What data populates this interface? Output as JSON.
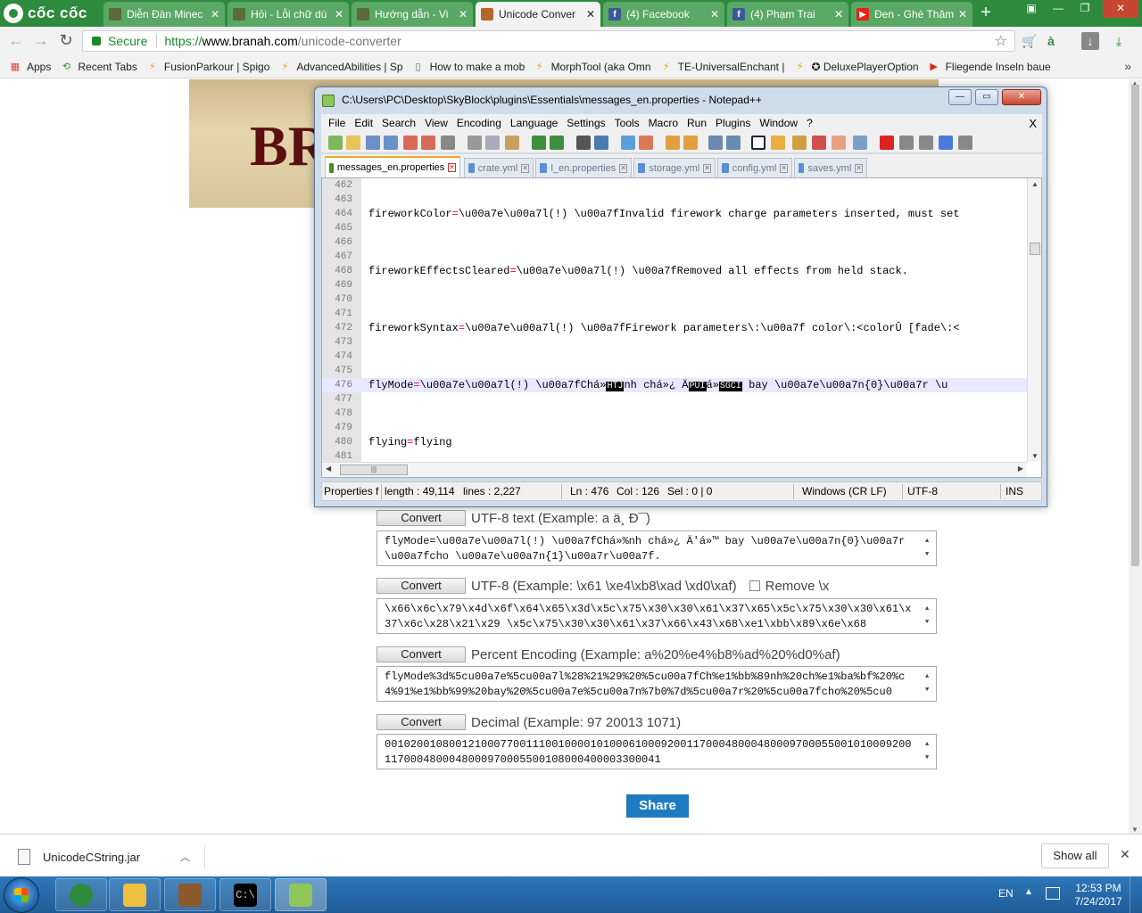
{
  "browser": {
    "brand": "cốc cốc",
    "tabs": [
      {
        "title": "Diễn Đàn Minec",
        "icon": "minecraft-icon",
        "active": false
      },
      {
        "title": "Hỏi - Lỗi chữ dù",
        "icon": "minecraft-icon",
        "active": false
      },
      {
        "title": "Hướng dẫn - Vi",
        "icon": "minecraft-icon",
        "active": false
      },
      {
        "title": "Unicode Conver",
        "icon": "branah-icon",
        "active": true
      },
      {
        "title": "(4) Facebook",
        "icon": "facebook-icon",
        "active": false
      },
      {
        "title": "(4) Phạm Trai",
        "icon": "facebook-icon",
        "active": false
      },
      {
        "title": "Đen - Ghé Thăm",
        "icon": "youtube-icon",
        "active": false
      }
    ],
    "secure_label": "Secure",
    "url_scheme": "https://",
    "url_host": "www.branah.com",
    "url_path": "/unicode-converter",
    "bookmarks": [
      {
        "label": "Apps",
        "icon": "apps-grid-icon"
      },
      {
        "label": "Recent Tabs",
        "icon": "recent-tabs-icon"
      },
      {
        "label": "FusionParkour | Spigo",
        "icon": "spigot-icon"
      },
      {
        "label": "AdvancedAbilities | Sp",
        "icon": "spigot-icon"
      },
      {
        "label": "How to make a mob s",
        "icon": "page-icon"
      },
      {
        "label": "MorphTool (aka Omn",
        "icon": "spigot-icon"
      },
      {
        "label": "TE-UniversalEnchant |",
        "icon": "spigot-icon"
      },
      {
        "label": "✪ DeluxePlayerOption",
        "icon": "spigot-icon"
      },
      {
        "label": "Fliegende Inseln baue",
        "icon": "youtube-icon"
      }
    ]
  },
  "page": {
    "banner_word": "BRA",
    "converters": [
      {
        "button": "Convert",
        "label": "UTF-8 text (Example: a ä¸­ Ð¯)",
        "checkbox": null,
        "value": "flyMode=\\u00a7e\\u00a7l(!) \\u00a7fChá»%nh chá»¿ Ä'á»™ bay \\u00a7e\\u00a7n{0}\\u00a7r \\u00a7fcho \\u00a7e\\u00a7n{1}\\u00a7r\\u00a7f."
      },
      {
        "button": "Convert",
        "label": "UTF-8 (Example: \\x61 \\xe4\\xb8\\xad \\xd0\\xaf)",
        "checkbox": "Remove \\x",
        "value": "\\x66\\x6c\\x79\\x4d\\x6f\\x64\\x65\\x3d\\x5c\\x75\\x30\\x30\\x61\\x37\\x65\\x5c\\x75\\x30\\x30\\x61\\x37\\x6c\\x28\\x21\\x29 \\x5c\\x75\\x30\\x30\\x61\\x37\\x66\\x43\\x68\\xe1\\xbb\\x89\\x6e\\x68"
      },
      {
        "button": "Convert",
        "label": "Percent Encoding (Example: a%20%e4%b8%ad%20%d0%af)",
        "checkbox": null,
        "value": "flyMode%3d%5cu00a7e%5cu00a7l%28%21%29%20%5cu00a7fCh%e1%bb%89nh%20ch%e1%ba%bf%20%c4%91%e1%bb%99%20bay%20%5cu00a7e%5cu00a7n%7b0%7d%5cu00a7r%20%5cu00a7fcho%20%5cu0"
      },
      {
        "button": "Convert",
        "label": "Decimal (Example: 97 20013 1071)",
        "checkbox": null,
        "value": "00102001080012100077001110010000101000610009200117000480004800097000550010100092001170004800048000970005500108000400003300041"
      }
    ],
    "share_label": "Share"
  },
  "notepad": {
    "title": "C:\\Users\\PC\\Desktop\\SkyBlock\\plugins\\Essentials\\messages_en.properties - Notepad++",
    "menu": [
      "File",
      "Edit",
      "Search",
      "View",
      "Encoding",
      "Language",
      "Settings",
      "Tools",
      "Macro",
      "Run",
      "Plugins",
      "Window",
      "?"
    ],
    "menu_close": "X",
    "file_tabs": [
      {
        "name": "messages_en.properties",
        "active": true
      },
      {
        "name": "crate.yml",
        "active": false
      },
      {
        "name": "l_en.properties",
        "active": false
      },
      {
        "name": "storage.yml",
        "active": false
      },
      {
        "name": "config.yml",
        "active": false
      },
      {
        "name": "saves.yml",
        "active": false
      }
    ],
    "lines": [
      {
        "no": "462",
        "key": "",
        "eq": "",
        "val": ""
      },
      {
        "no": "463",
        "key": "",
        "eq": "",
        "val": ""
      },
      {
        "no": "464",
        "key": "fireworkColor",
        "eq": "=",
        "val": "\\u00a7e\\u00a7l(!) \\u00a7fInvalid firework charge parameters inserted, must set"
      },
      {
        "no": "465",
        "key": "",
        "eq": "",
        "val": ""
      },
      {
        "no": "466",
        "key": "",
        "eq": "",
        "val": ""
      },
      {
        "no": "467",
        "key": "",
        "eq": "",
        "val": ""
      },
      {
        "no": "468",
        "key": "fireworkEffectsCleared",
        "eq": "=",
        "val": "\\u00a7e\\u00a7l(!) \\u00a7fRemoved all effects from held stack."
      },
      {
        "no": "469",
        "key": "",
        "eq": "",
        "val": ""
      },
      {
        "no": "470",
        "key": "",
        "eq": "",
        "val": ""
      },
      {
        "no": "471",
        "key": "",
        "eq": "",
        "val": ""
      },
      {
        "no": "472",
        "key": "fireworkSyntax",
        "eq": "=",
        "val": "\\u00a7e\\u00a7l(!) \\u00a7fFirework parameters\\:\\u00a7f color\\:<colorÛ [fade\\:<"
      },
      {
        "no": "473",
        "key": "",
        "eq": "",
        "val": ""
      },
      {
        "no": "474",
        "key": "",
        "eq": "",
        "val": ""
      },
      {
        "no": "475",
        "key": "",
        "eq": "",
        "val": ""
      },
      {
        "no": "476",
        "key": "flyMode",
        "eq": "=",
        "val": "\\u00a7e\\u00a7l(!) \\u00a7fChá»",
        "blk1": "HTJ",
        "val2": "nh chá»¿ Ä",
        "blk2": "PUI",
        "val3": "á»",
        "blk3": "SGCI",
        "val4": " bay \\u00a7e\\u00a7n{0}\\u00a7r \\u",
        "current": true
      },
      {
        "no": "477",
        "key": "",
        "eq": "",
        "val": ""
      },
      {
        "no": "478",
        "key": "",
        "eq": "",
        "val": ""
      },
      {
        "no": "479",
        "key": "",
        "eq": "",
        "val": ""
      },
      {
        "no": "480",
        "key": "flying",
        "eq": "=",
        "val": "flying"
      },
      {
        "no": "481",
        "key": "",
        "eq": "",
        "val": ""
      }
    ],
    "status": {
      "type": "Properties fi",
      "length": "length : 49,114",
      "lines": "lines : 2,227",
      "ln": "Ln : 476",
      "col": "Col : 126",
      "sel": "Sel : 0 | 0",
      "eol": "Windows (CR LF)",
      "encoding": "UTF-8",
      "mode": "INS"
    }
  },
  "downloads": {
    "file": "UnicodeCString.jar",
    "show_all": "Show all"
  },
  "taskbar": {
    "lang": "EN",
    "time": "12:53 PM",
    "date": "7/24/2017",
    "apps": [
      "coccoc-browser-icon",
      "file-explorer-icon",
      "minecraft-icon",
      "command-prompt-icon",
      "notepad-plus-plus-icon"
    ]
  }
}
